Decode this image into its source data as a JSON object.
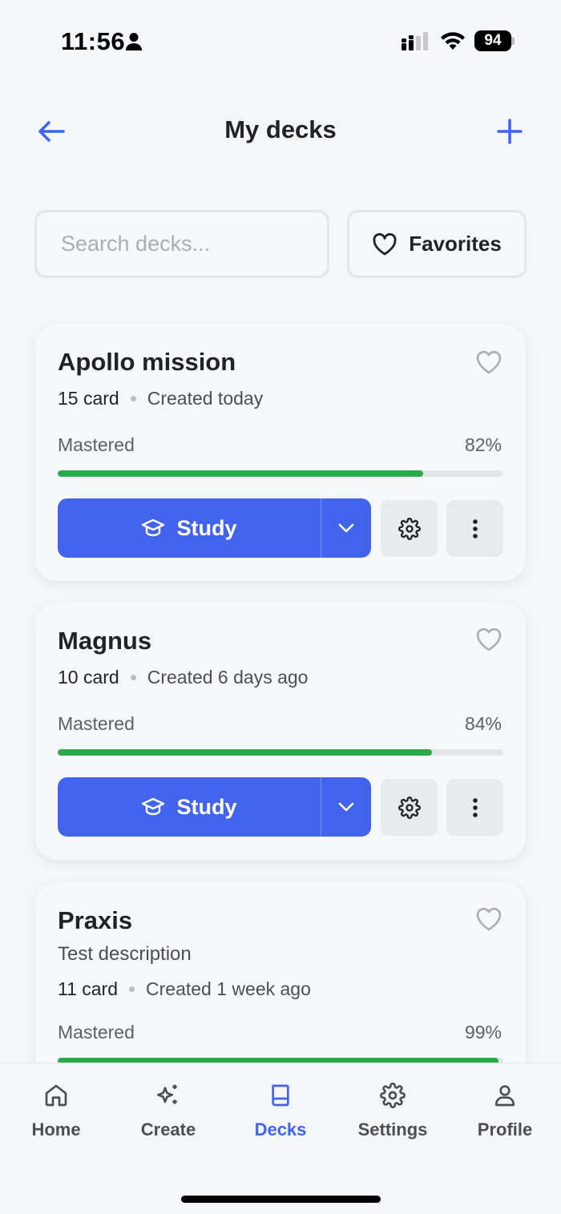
{
  "status_bar": {
    "time": "11:56",
    "battery": "94"
  },
  "header": {
    "title": "My decks",
    "back_icon": "arrow-left-icon",
    "add_icon": "plus-icon"
  },
  "search": {
    "placeholder": "Search decks...",
    "value": ""
  },
  "favorites": {
    "label": "Favorites"
  },
  "decks": [
    {
      "title": "Apollo mission",
      "count": "15 card",
      "created": "Created today",
      "mastered_label": "Mastered",
      "mastered_pct": "82%",
      "progress": 0.82,
      "study_label": "Study"
    },
    {
      "title": "Magnus",
      "count": "10 card",
      "created": "Created 6 days ago",
      "mastered_label": "Mastered",
      "mastered_pct": "84%",
      "progress": 0.84,
      "study_label": "Study"
    },
    {
      "title": "Praxis",
      "description": "Test description",
      "count": "11 card",
      "created": "Created 1 week ago",
      "mastered_label": "Mastered",
      "mastered_pct": "99%",
      "progress": 0.99
    }
  ],
  "tabs": [
    {
      "label": "Home",
      "icon": "home-icon"
    },
    {
      "label": "Create",
      "icon": "sparkles-icon"
    },
    {
      "label": "Decks",
      "icon": "book-icon",
      "active": true
    },
    {
      "label": "Settings",
      "icon": "gear-icon"
    },
    {
      "label": "Profile",
      "icon": "user-icon"
    }
  ],
  "colors": {
    "accent": "#4263eb",
    "progress": "#2ea84a",
    "background": "#f5f6f8"
  }
}
